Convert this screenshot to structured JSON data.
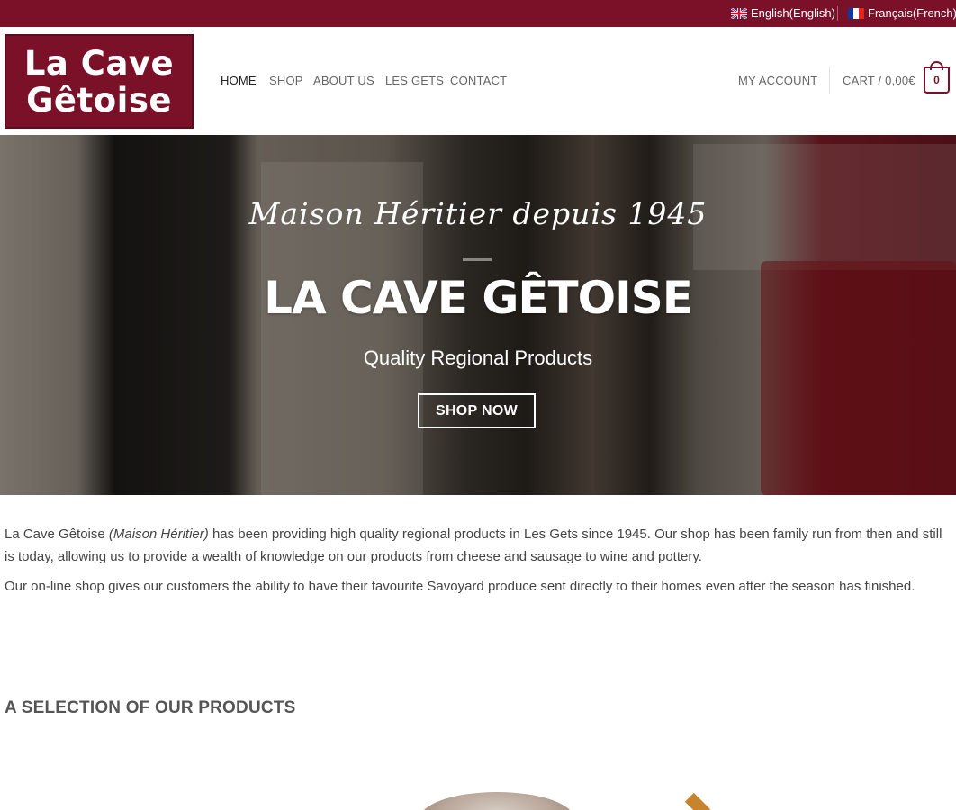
{
  "topbar": {
    "languages": [
      {
        "label": "English(English)",
        "flag": "uk-flag-icon"
      },
      {
        "label": "Français(French)",
        "flag": "france-flag-icon"
      }
    ]
  },
  "header": {
    "logo_line1": "La Cave",
    "logo_line2": "Gêtoise",
    "nav": [
      {
        "label": "HOME",
        "active": true
      },
      {
        "label": "SHOP"
      },
      {
        "label": "ABOUT US"
      },
      {
        "label": "LES GETS"
      },
      {
        "label": "CONTACT"
      }
    ],
    "account_label": "MY ACCOUNT",
    "cart_label": "CART / 0,00€",
    "cart_count": "0"
  },
  "hero": {
    "script_title": "Maison Héritier depuis 1945",
    "title": "LA CAVE GÊTOISE",
    "subtitle": "Quality Regional Products",
    "button_label": "SHOP NOW"
  },
  "intro": {
    "p1_name": "La Cave Gêtoise",
    "p1_em": "(Maison Héritier)",
    "p1_rest": "has been providing high quality regional products in Les Gets since 1945. Our shop has been family run from then and still is today, allowing us to provide a wealth of knowledge on our products from cheese and sausage to wine and pottery.",
    "p2": "Our on-line shop gives our customers the ability to have their favourite Savoyard produce sent directly to their homes even after the season has finished."
  },
  "section_title": "A SELECTION OF OUR PRODUCTS",
  "colors": {
    "brand": "#7b1128",
    "text": "#444444"
  }
}
